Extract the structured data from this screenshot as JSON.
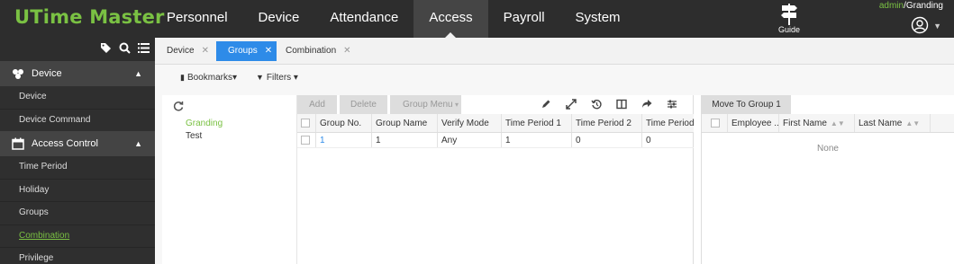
{
  "app": {
    "logo": "UTime Master",
    "nav": [
      "Personnel",
      "Device",
      "Attendance",
      "Access",
      "Payroll",
      "System"
    ],
    "active_nav": "Access",
    "guide_label": "Guide",
    "user_admin": "admin",
    "user_sep": "/",
    "user_name": "Granding"
  },
  "sidebar": {
    "groups": [
      {
        "label": "Device",
        "icon": "device-cluster-icon",
        "expanded": true,
        "items": [
          "Device",
          "Device Command"
        ]
      },
      {
        "label": "Access Control",
        "icon": "calendar-icon",
        "expanded": true,
        "items": [
          "Time Period",
          "Holiday",
          "Groups",
          "Combination",
          "Privilege"
        ]
      }
    ],
    "active_item": "Combination"
  },
  "tabs": [
    {
      "label": "Device",
      "active": false
    },
    {
      "label": "Groups",
      "active": true
    },
    {
      "label": "Combination",
      "active": false
    }
  ],
  "filters": {
    "bookmarks": "Bookmarks",
    "filters": "Filters"
  },
  "tree": {
    "items": [
      {
        "label": "Granding",
        "selected": true
      },
      {
        "label": "Test",
        "selected": false
      }
    ]
  },
  "grid": {
    "buttons": {
      "add": "Add",
      "delete": "Delete",
      "group_menu": "Group Menu"
    },
    "columns": [
      "Group No.",
      "Group Name",
      "Verify Mode",
      "Time Period 1",
      "Time Period 2",
      "Time Period"
    ],
    "rows": [
      [
        "1",
        "1",
        "Any",
        "1",
        "0",
        "0"
      ]
    ]
  },
  "members": {
    "move_button": "Move To Group 1",
    "columns": [
      "Employee ...",
      "First Name",
      "Last Name"
    ],
    "empty_text": "None"
  },
  "colors": {
    "brand_green": "#7ac143",
    "accent_blue": "#2e8be8",
    "topbar": "#2d2d2d"
  }
}
